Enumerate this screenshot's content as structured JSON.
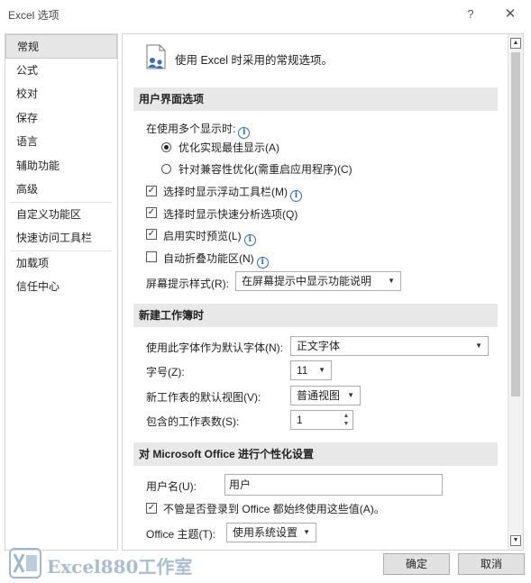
{
  "window": {
    "title": "Excel 选项",
    "help_label": "?",
    "close_label": "✕"
  },
  "nav": {
    "items": [
      {
        "label": "常规",
        "active": true
      },
      {
        "label": "公式"
      },
      {
        "label": "校对"
      },
      {
        "label": "保存"
      },
      {
        "label": "语言"
      },
      {
        "label": "辅助功能"
      },
      {
        "label": "高级"
      },
      {
        "label": "自定义功能区"
      },
      {
        "label": "快速访问工具栏"
      },
      {
        "label": "加载项"
      },
      {
        "label": "信任中心"
      }
    ]
  },
  "general": {
    "header": "使用 Excel 时采用的常规选项。"
  },
  "ui_section": {
    "title": "用户界面选项",
    "multi_display_label": "在使用多个显示时:",
    "radio_optimize": "优化实现最佳显示(A)",
    "radio_compat": "针对兼容性优化(需重启应用程序)(C)",
    "chk_mini_toolbar": "选择时显示浮动工具栏(M)",
    "chk_quick_analysis": "选择时显示快速分析选项(Q)",
    "chk_live_preview": "启用实时预览(L)",
    "chk_collapse_ribbon": "自动折叠功能区(N)",
    "screentip_label": "屏幕提示样式(R):",
    "screentip_value": "在屏幕提示中显示功能说明"
  },
  "new_wb_section": {
    "title": "新建工作簿时",
    "font_label": "使用此字体作为默认字体(N):",
    "font_value": "正文字体",
    "size_label": "字号(Z):",
    "size_value": "11",
    "view_label": "新工作表的默认视图(V):",
    "view_value": "普通视图",
    "sheets_label": "包含的工作表数(S):",
    "sheets_value": "1"
  },
  "personalize_section": {
    "title": "对 Microsoft Office 进行个性化设置",
    "username_label": "用户名(U):",
    "username_value": "用户",
    "always_use_label": "不管是否登录到 Office 都始终使用这些值(A)。",
    "theme_label": "Office 主题(T):",
    "theme_value": "使用系统设置"
  },
  "footer": {
    "ok_label": "确定",
    "cancel_label": "取消",
    "watermark": "Excel880工作室"
  },
  "colors": {
    "section_bg": "#e8e8e8",
    "nav_active_bg": "#e6e6e6",
    "info_blue": "#2b6cb0"
  }
}
